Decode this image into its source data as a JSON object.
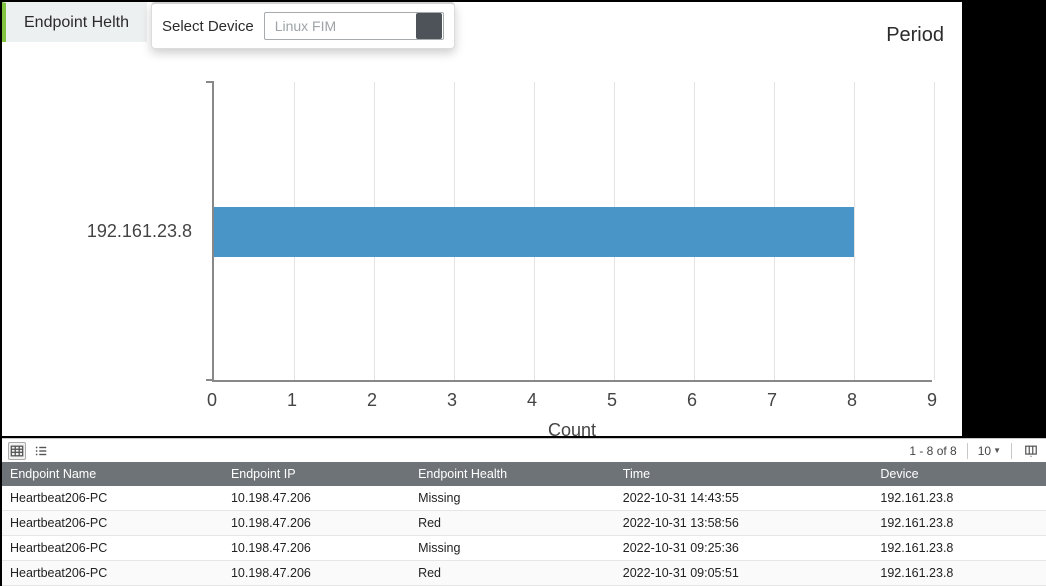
{
  "tab": {
    "title": "Endpoint Helth"
  },
  "selector": {
    "label": "Select Device",
    "chip_text": "Linux FIM"
  },
  "period_label": "Period",
  "chart_data": {
    "type": "bar",
    "orientation": "horizontal",
    "categories": [
      "192.161.23.8"
    ],
    "values": [
      8
    ],
    "xlabel": "Count",
    "xlim": [
      0,
      9
    ],
    "xticks": [
      0,
      1,
      2,
      3,
      4,
      5,
      6,
      7,
      8,
      9
    ],
    "bar_color": "#4a95c8"
  },
  "table_toolbar": {
    "range_text": "1 - 8 of 8",
    "page_size": "10"
  },
  "table": {
    "columns": [
      "Endpoint Name",
      "Endpoint IP",
      "Endpoint Health",
      "Time",
      "Device"
    ],
    "rows": [
      {
        "name": "Heartbeat206-PC",
        "ip": "10.198.47.206",
        "health": "Missing",
        "time": "2022-10-31 14:43:55",
        "device": "192.161.23.8"
      },
      {
        "name": "Heartbeat206-PC",
        "ip": "10.198.47.206",
        "health": "Red",
        "time": "2022-10-31 13:58:56",
        "device": "192.161.23.8"
      },
      {
        "name": "Heartbeat206-PC",
        "ip": "10.198.47.206",
        "health": "Missing",
        "time": "2022-10-31 09:25:36",
        "device": "192.161.23.8"
      },
      {
        "name": "Heartbeat206-PC",
        "ip": "10.198.47.206",
        "health": "Red",
        "time": "2022-10-31 09:05:51",
        "device": "192.161.23.8"
      }
    ]
  }
}
